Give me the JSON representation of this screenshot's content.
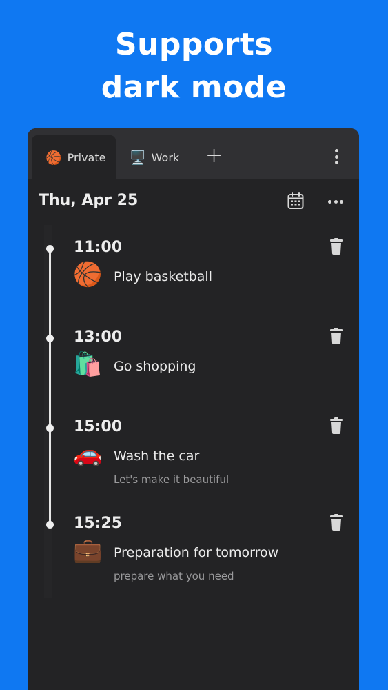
{
  "headline": {
    "line1": "Supports",
    "line2": "dark mode"
  },
  "tabs": [
    {
      "icon": "🏀",
      "label": "Private"
    },
    {
      "icon": "🖥️",
      "label": "Work"
    }
  ],
  "add_tab_label": "+",
  "date": "Thu, Apr 25",
  "events": [
    {
      "time": "11:00",
      "icon": "🏀",
      "title": "Play basketball",
      "note": ""
    },
    {
      "time": "13:00",
      "icon": "🛍️",
      "title": "Go shopping",
      "note": ""
    },
    {
      "time": "15:00",
      "icon": "🚗",
      "title": "Wash the car",
      "note": "Let's make it beautiful"
    },
    {
      "time": "15:25",
      "icon": "💼",
      "title": "Preparation for tomorrow",
      "note": "prepare what you need"
    }
  ]
}
